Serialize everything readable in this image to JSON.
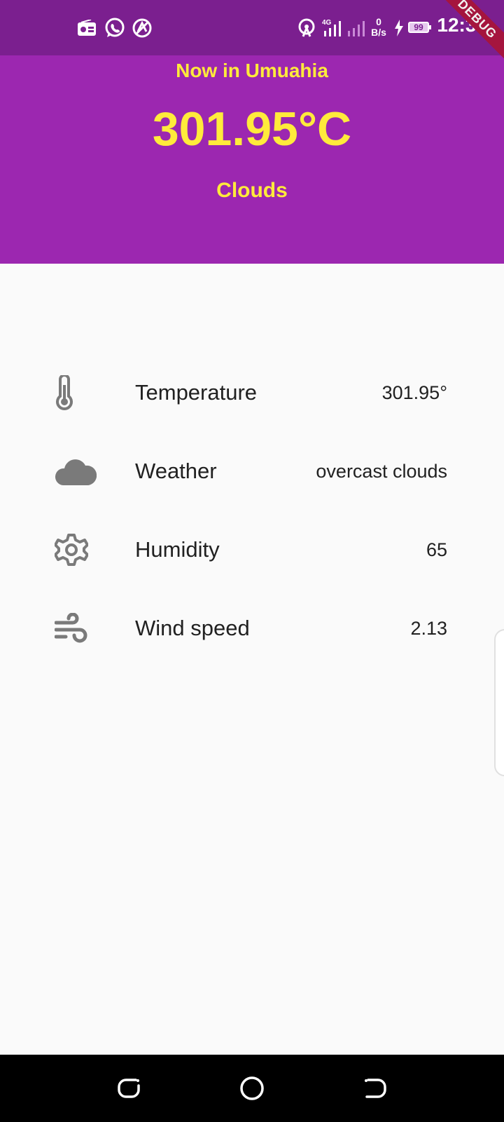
{
  "status_bar": {
    "time": "12:34",
    "net_speed_value": "0",
    "net_speed_unit": "B/s",
    "network_type": "4G",
    "battery_level": "99",
    "left_icons": [
      "radio-icon",
      "whatsapp-icon",
      "vpn-icon"
    ],
    "right_icons": [
      "hotspot-icon",
      "signal-icon",
      "signal-icon",
      "charging-icon",
      "battery-icon"
    ]
  },
  "debug_banner": "DEBUG",
  "header": {
    "location": "Now in Umuahia",
    "temperature": "301.95°C",
    "condition": "Clouds",
    "background_color": "#9c27b0",
    "text_color": "#ffeb3b"
  },
  "details": [
    {
      "icon": "thermometer-icon",
      "label": "Temperature",
      "value": "301.95°"
    },
    {
      "icon": "cloud-icon",
      "label": "Weather",
      "value": "overcast clouds"
    },
    {
      "icon": "gear-icon",
      "label": "Humidity",
      "value": "65"
    },
    {
      "icon": "wind-icon",
      "label": "Wind speed",
      "value": "2.13"
    }
  ],
  "nav_bar": {
    "buttons": [
      "recent-apps-button",
      "home-button",
      "back-button"
    ]
  }
}
